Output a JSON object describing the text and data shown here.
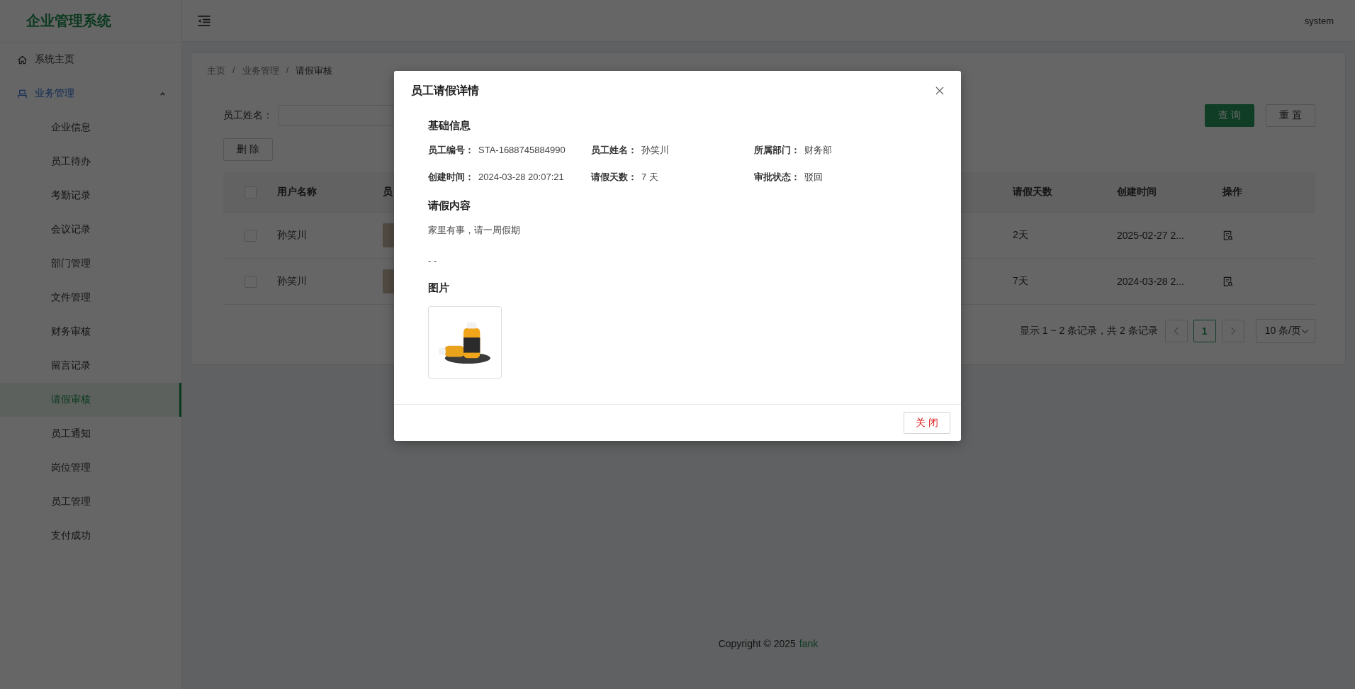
{
  "sidebar": {
    "title": "企业管理系统",
    "items": [
      {
        "kind": "home",
        "label": "系统主页"
      },
      {
        "kind": "group",
        "label": "业务管理",
        "expanded": true,
        "children": [
          {
            "label": "企业信息",
            "selected": false
          },
          {
            "label": "员工待办",
            "selected": false
          },
          {
            "label": "考勤记录",
            "selected": false
          },
          {
            "label": "会议记录",
            "selected": false
          },
          {
            "label": "部门管理",
            "selected": false
          },
          {
            "label": "文件管理",
            "selected": false
          },
          {
            "label": "财务审核",
            "selected": false
          },
          {
            "label": "留言记录",
            "selected": false
          },
          {
            "label": "请假审核",
            "selected": true
          },
          {
            "label": "员工通知",
            "selected": false
          },
          {
            "label": "岗位管理",
            "selected": false
          },
          {
            "label": "员工管理",
            "selected": false
          },
          {
            "label": "支付成功",
            "selected": false
          }
        ]
      }
    ]
  },
  "header": {
    "user": "system"
  },
  "breadcrumb": {
    "separator": "/",
    "items": [
      "主页",
      "业务管理",
      "请假审核"
    ]
  },
  "search": {
    "label": "员工姓名：",
    "buttons": [
      {
        "kind": "primary",
        "label": "查 询"
      },
      {
        "kind": "default",
        "label": "重 置"
      }
    ]
  },
  "toolbar": {
    "delete": "删 除"
  },
  "table": {
    "select_all": {
      "checked": false
    },
    "columns": [
      "用户名称",
      "员",
      "请假天数",
      "创建时间",
      "操作"
    ],
    "rows": [
      {
        "checked": false,
        "user": "孙笑川",
        "days": "2天",
        "created": "2025-02-27 2..."
      },
      {
        "checked": false,
        "user": "孙笑川",
        "days": "7天",
        "created": "2024-03-28 2..."
      }
    ]
  },
  "pagination": {
    "summary": "显示 1 ~ 2 条记录，共 2 条记录",
    "pages": [
      {
        "label": "1",
        "selected": true
      }
    ],
    "page_size": "10 条/页"
  },
  "footer": {
    "text": "Copyright © 2025",
    "link": "fank"
  },
  "modal": {
    "title": "员工请假详情",
    "sections": [
      {
        "kind": "fields",
        "title": "基础信息",
        "fields": [
          {
            "label": "员工编号：",
            "value": "STA-1688745884990"
          },
          {
            "label": "员工姓名：",
            "value": "孙笑川"
          },
          {
            "label": "所属部门：",
            "value": "财务部"
          },
          {
            "label": "创建时间：",
            "value": "2024-03-28 20:07:21"
          },
          {
            "label": "请假天数：",
            "value": "7 天"
          },
          {
            "label": "审批状态：",
            "value": "驳回"
          }
        ]
      },
      {
        "kind": "text",
        "title": "请假内容",
        "paragraphs": [
          "家里有事，请一周假期",
          "- -"
        ]
      },
      {
        "kind": "image",
        "title": "图片"
      }
    ],
    "close_button": "关 闭"
  }
}
